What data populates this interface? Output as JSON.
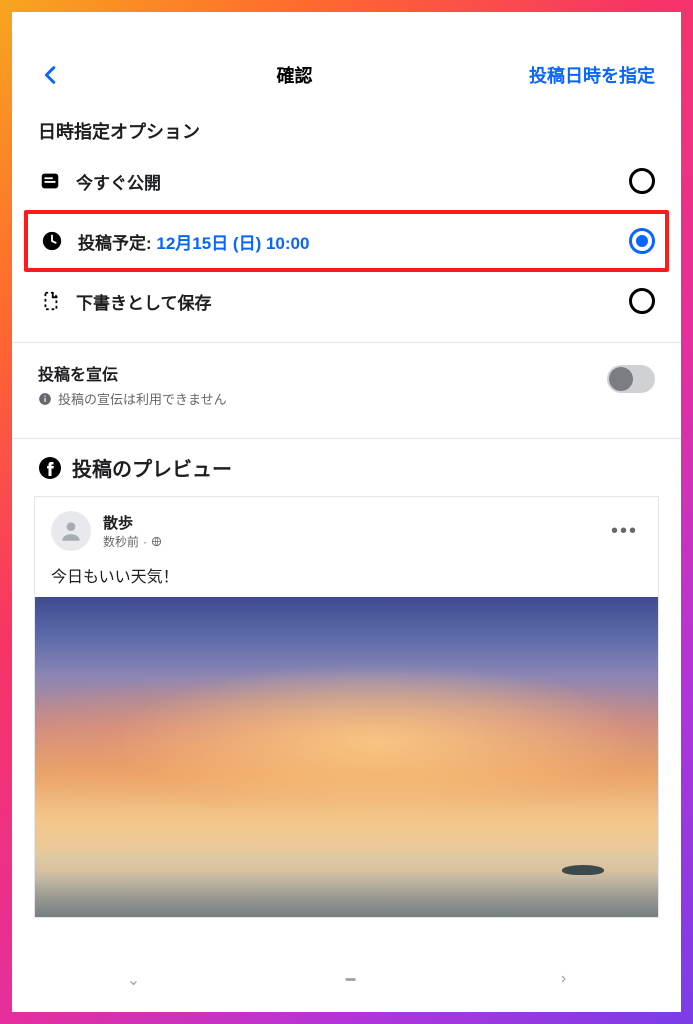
{
  "header": {
    "title": "確認",
    "action_label": "投稿日時を指定"
  },
  "schedule": {
    "section_title": "日時指定オプション",
    "options": [
      {
        "label": "今すぐ公開",
        "selected": false
      },
      {
        "label_prefix": "投稿予定: ",
        "label_value": "12月15日 (日) 10:00",
        "selected": true,
        "highlighted": true
      },
      {
        "label": "下書きとして保存",
        "selected": false
      }
    ]
  },
  "promote": {
    "title": "投稿を宣伝",
    "note": "投稿の宣伝は利用できません",
    "enabled": false
  },
  "preview": {
    "title": "投稿のプレビュー",
    "author": "散歩",
    "meta": "数秒前",
    "body": "今日もいい天気！"
  }
}
